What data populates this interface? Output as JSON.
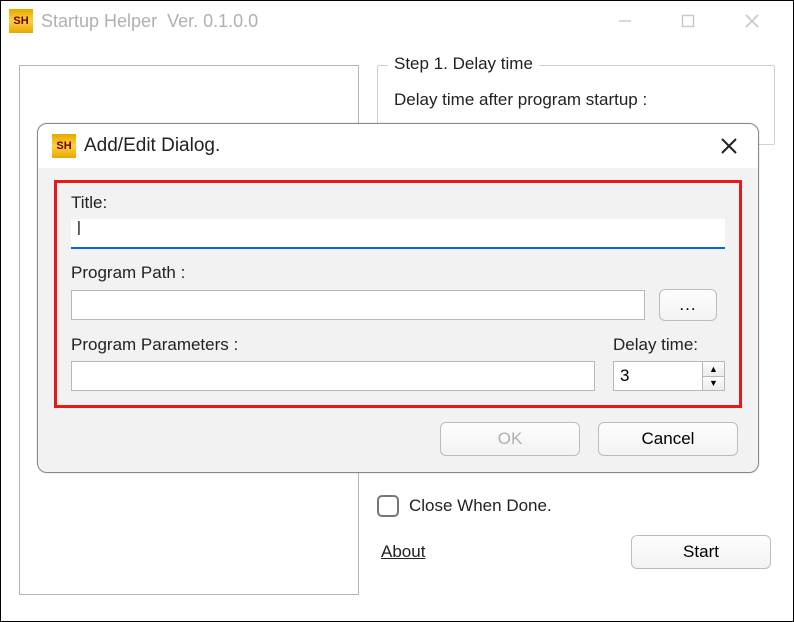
{
  "main": {
    "icon_text": "SH",
    "title": "Startup Helper",
    "version": "Ver. 0.1.0.0"
  },
  "step1": {
    "title": "Step 1. Delay time",
    "body": "Delay time after program startup :"
  },
  "closeWhenDone": "Close When Done.",
  "aboutLabel": "About",
  "startLabel": "Start",
  "dialog": {
    "icon_text": "SH",
    "title": "Add/Edit Dialog.",
    "titleLabel": "Title:",
    "titleValue": "",
    "pathLabel": "Program Path :",
    "pathValue": "",
    "browseLabel": "...",
    "paramsLabel": "Program Parameters :",
    "paramsValue": "",
    "delayLabel": "Delay time:",
    "delayValue": "3",
    "okLabel": "OK",
    "cancelLabel": "Cancel"
  }
}
